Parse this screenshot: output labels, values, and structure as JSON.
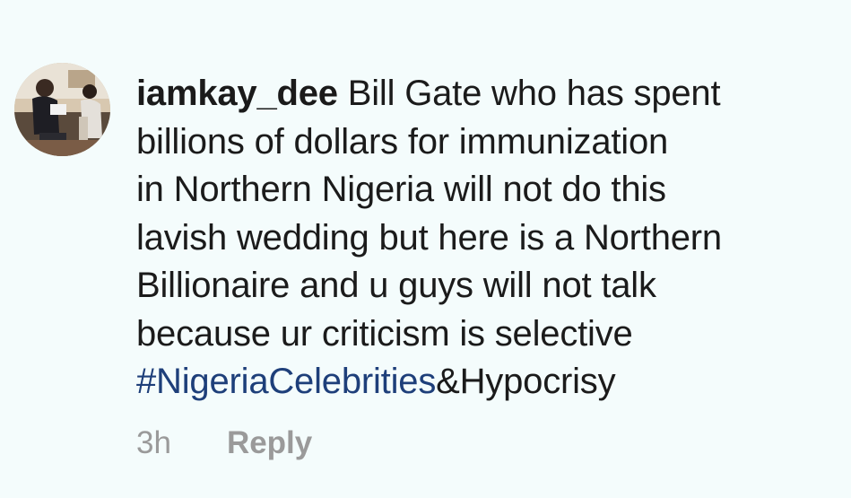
{
  "comment": {
    "username": "iamkay_dee",
    "lines": [
      " Bill Gate who has spent",
      "billions of dollars for immunization",
      "in Northern Nigeria will not do this",
      "lavish wedding but here is a Northern",
      "Billionaire and u guys will not talk",
      "because ur criticism is selective"
    ],
    "hashtag": "#NigeriaCelebrities",
    "hashtag_suffix": "&Hypocrisy",
    "time": "3h",
    "reply_label": "Reply"
  },
  "colors": {
    "background": "#f4fcfc",
    "text": "#1b1b1b",
    "hashtag": "#1e3f7a",
    "meta": "#9a9a9a"
  },
  "icons": {
    "avatar": "user-avatar-photo"
  }
}
